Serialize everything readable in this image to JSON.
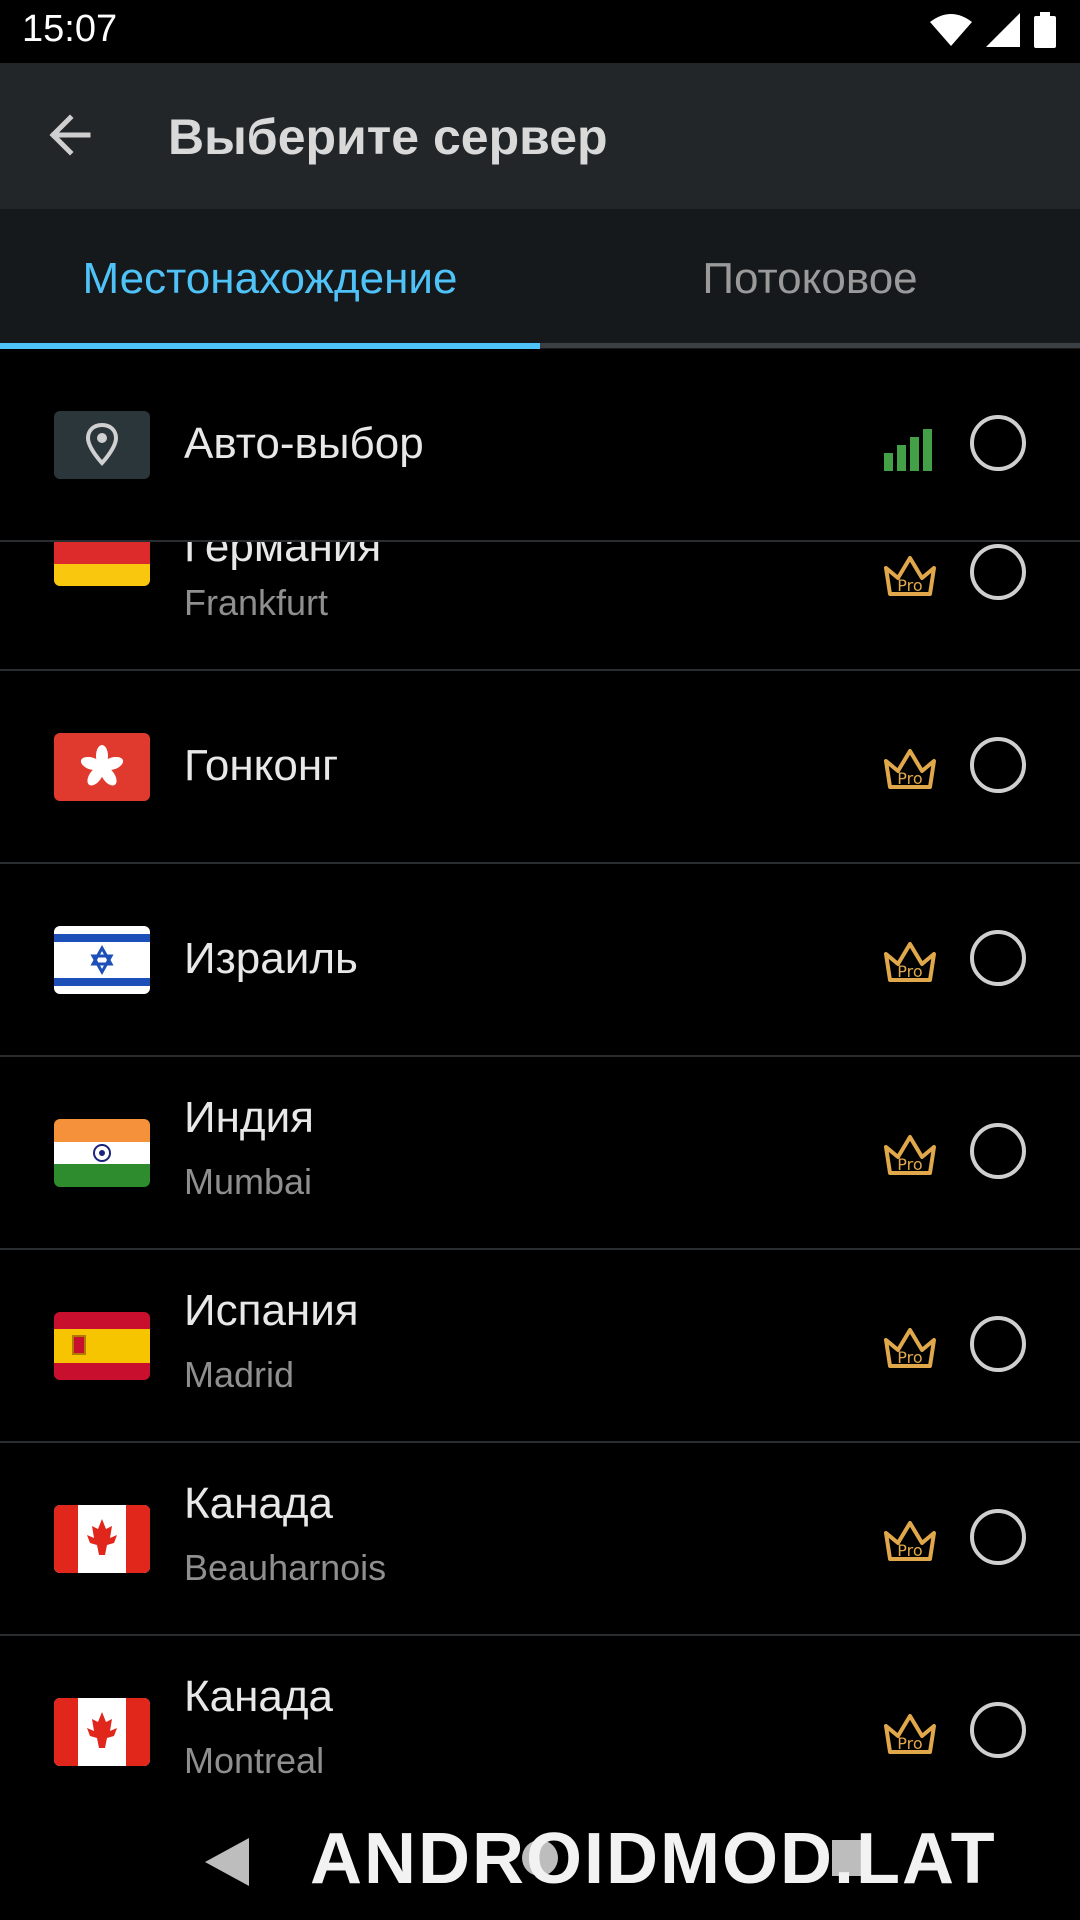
{
  "status_bar": {
    "time": "15:07",
    "icons": [
      "wifi-icon",
      "signal-icon",
      "battery-icon"
    ]
  },
  "app_bar": {
    "title": "Выберите сервер",
    "back_icon": "arrow-left-icon"
  },
  "tabs": [
    {
      "label": "Местонахождение",
      "active": true
    },
    {
      "label": "Потоковое",
      "active": false
    }
  ],
  "servers": [
    {
      "title": "Авто-выбор",
      "subtitle": "",
      "icon": "location-pin-icon",
      "badge": "signal-bars"
    },
    {
      "title": "Германия",
      "subtitle": "Frankfurt",
      "flag": "de",
      "badge": "pro"
    },
    {
      "title": "Гонконг",
      "subtitle": "",
      "flag": "hk",
      "badge": "pro"
    },
    {
      "title": "Израиль",
      "subtitle": "",
      "flag": "il",
      "badge": "pro"
    },
    {
      "title": "Индия",
      "subtitle": "Mumbai",
      "flag": "in",
      "badge": "pro"
    },
    {
      "title": "Испания",
      "subtitle": "Madrid",
      "flag": "es",
      "badge": "pro"
    },
    {
      "title": "Канада",
      "subtitle": "Beauharnois",
      "flag": "ca",
      "badge": "pro"
    },
    {
      "title": "Канада",
      "subtitle": "Montreal",
      "flag": "ca",
      "badge": "pro"
    }
  ],
  "pro_label": "Pro",
  "watermark": "ANDROIDMOD.LAT",
  "colors": {
    "accent": "#4fc3f7",
    "pro_gold": "#e0a84a",
    "signal_green": "#43a047"
  }
}
